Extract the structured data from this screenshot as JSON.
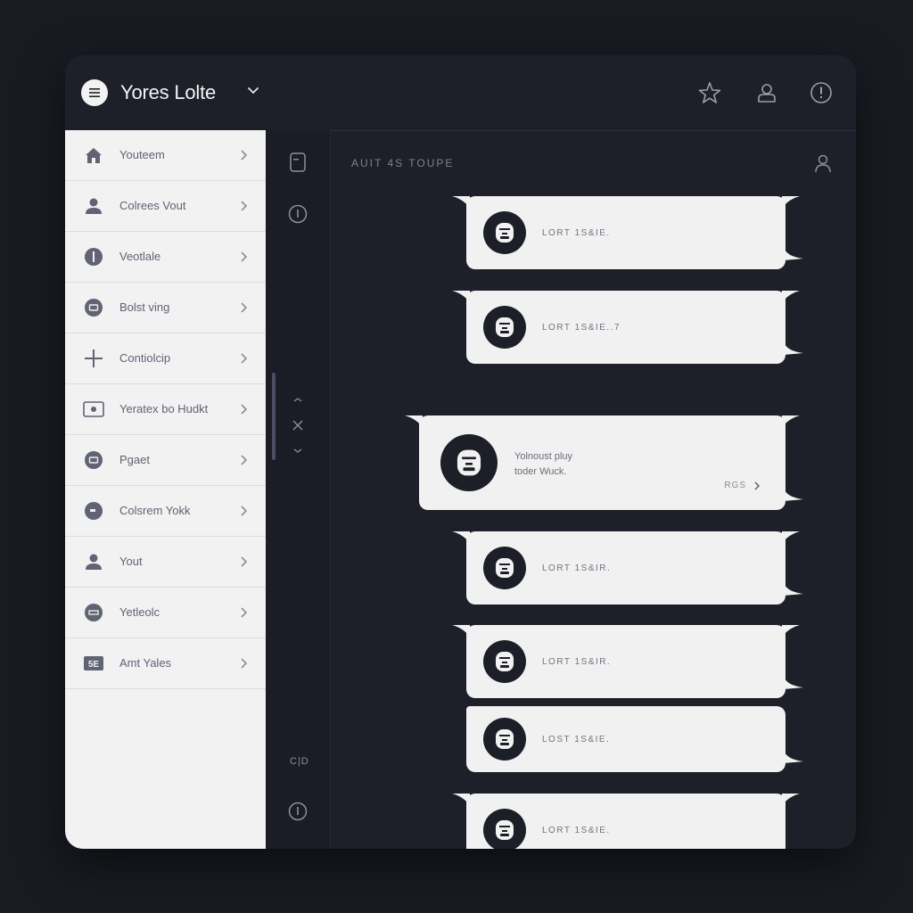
{
  "header": {
    "title": "Yores Lolte"
  },
  "sidebar": {
    "items": [
      {
        "label": "Youteem",
        "icon": "home-icon"
      },
      {
        "label": "Colrees Vout",
        "icon": "user-icon"
      },
      {
        "label": "Veotlale",
        "icon": "info-icon"
      },
      {
        "label": "Bolst ving",
        "icon": "chat-icon"
      },
      {
        "label": "Contiolcip",
        "icon": "plus-icon"
      },
      {
        "label": "Yeratex bo Hudkt",
        "icon": "card-icon"
      },
      {
        "label": "Pgaet",
        "icon": "chat-icon"
      },
      {
        "label": "Colsrem Yokk",
        "icon": "chat-icon"
      },
      {
        "label": "Yout",
        "icon": "user-icon"
      },
      {
        "label": "Yetleolc",
        "icon": "chat-icon"
      },
      {
        "label": "Amt Yales",
        "icon": "badge-icon",
        "badge": "5E"
      }
    ]
  },
  "rail": {
    "bottom_label": "C|D"
  },
  "main": {
    "title": "AUIT 4S TOUPE",
    "messages": [
      {
        "text": "LORT 1S&IE."
      },
      {
        "text": "LORT 1S&IE..7"
      },
      {
        "line1": "Yolnoust pluy",
        "line2": "toder Wuck.",
        "link": "RGS"
      },
      {
        "text": "LORT 1S&IR."
      },
      {
        "text": "LORT 1S&IR."
      },
      {
        "text": "LOST 1S&IE."
      },
      {
        "text": "LORT 1S&IE."
      }
    ]
  },
  "colors": {
    "background": "#181b22",
    "panel": "#1d2029",
    "sidebar": "#f2f2f2",
    "bubble": "#f1f1f1",
    "icon": "#5f6374"
  }
}
